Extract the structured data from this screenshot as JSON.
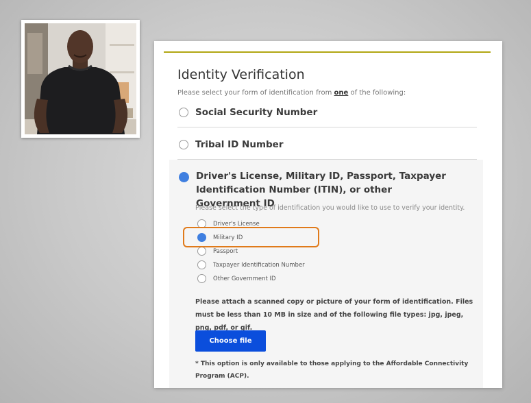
{
  "presenter": {
    "photo_alt": "Presenter photo"
  },
  "form": {
    "title": "Identity Verification",
    "subtitle_before": "Please select your form of identification from ",
    "subtitle_emphasis": "one",
    "subtitle_after": " of the following:",
    "options": [
      {
        "label": "Social Security Number",
        "selected": false
      },
      {
        "label": "Tribal ID Number",
        "selected": false
      },
      {
        "label": "Driver's License, Military ID, Passport, Taxpayer Identification Number (ITIN), or other Government ID",
        "selected": true
      }
    ],
    "id_type_instruction": "Please select the type of identification you would like to use to verify your identity.",
    "id_types": [
      {
        "label": "Driver's License",
        "selected": false
      },
      {
        "label": "Military ID",
        "selected": true
      },
      {
        "label": "Passport",
        "selected": false
      },
      {
        "label": "Taxpayer Identification Number",
        "selected": false
      },
      {
        "label": "Other Government ID",
        "selected": false
      }
    ],
    "attach_text": "Please attach a scanned copy or picture of your form of identification. Files must be less than 10 MB in size and of the following file types: jpg, jpeg, png, pdf, or gif.",
    "choose_file_label": "Choose file",
    "footnote": "* This option is only available to those applying to the Affordable Connectivity Program (ACP)."
  },
  "colors": {
    "accent_rule": "#b1a612",
    "radio_selected": "#3f7fe0",
    "button": "#0b4edc",
    "highlight": "#e07a1a"
  }
}
